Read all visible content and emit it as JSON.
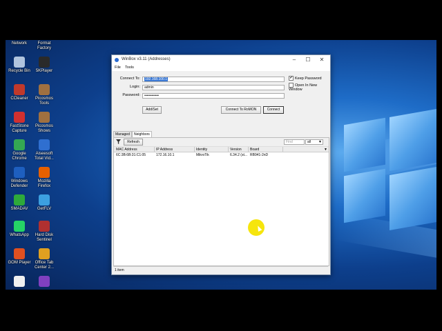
{
  "desktop": {
    "icons": [
      {
        "label": "Network",
        "color": "#4a8fd8"
      },
      {
        "label": "Format\nFactory",
        "color": "#d94a2a"
      },
      {
        "label": "Recycle Bin",
        "color": "#b0c4de"
      },
      {
        "label": "5KPlayer",
        "color": "#2a2a2a"
      },
      {
        "label": "CCleaner",
        "color": "#c0392b"
      },
      {
        "label": "Picosmos\nTools",
        "color": "#a07040"
      },
      {
        "label": "FastStone\nCapture",
        "color": "#d03030"
      },
      {
        "label": "Picosmos\nShows",
        "color": "#a07040"
      },
      {
        "label": "Google\nChrome",
        "color": "#34a853"
      },
      {
        "label": "Aiseesoft\nTotal Vid...",
        "color": "#2f6fd0"
      },
      {
        "label": "Windows\nDefender",
        "color": "#1e5fbf"
      },
      {
        "label": "Mozilla\nFirefox",
        "color": "#e66000"
      },
      {
        "label": "SMADAV",
        "color": "#2eaa3a"
      },
      {
        "label": "GetFLV",
        "color": "#3ca0e0"
      },
      {
        "label": "WhatsApp",
        "color": "#25d366"
      },
      {
        "label": "Hard Disk\nSentinel",
        "color": "#b03030"
      },
      {
        "label": "GOM Player",
        "color": "#e05020"
      },
      {
        "label": "Office Tab\nCenter 2...",
        "color": "#e0a020"
      },
      {
        "label": "",
        "color": "#f0f0f0"
      },
      {
        "label": "",
        "color": "#8040c0"
      }
    ]
  },
  "window": {
    "title": "WinBox v3.11 (Addresses)",
    "controls": {
      "minimize": "–",
      "maximize": "☐",
      "close": "✕"
    },
    "menu": [
      "File",
      "Tools"
    ],
    "connect_form": {
      "connect_to_label": "Connect To:",
      "connect_to_value": "192.168.100.1",
      "login_label": "Login:",
      "login_value": "admin",
      "password_label": "Password:",
      "password_value": "••••••••••••",
      "keep_password": {
        "label": "Keep Password",
        "checked": true,
        "mark": "✔"
      },
      "open_new_window": {
        "label": "Open In New Window",
        "checked": false
      },
      "add_set_button": "Add/Set",
      "connect_romon_button": "Connect To RoMON",
      "connect_button": "Connect"
    },
    "tabs": [
      "Managed",
      "Neighbors"
    ],
    "active_tab": "Neighbors",
    "toolbar": {
      "filter_icon": "funnel-icon",
      "refresh_button": "Refresh",
      "find_placeholder": "Find",
      "filter_select": "all"
    },
    "table": {
      "columns": [
        "MAC Address",
        "IP Address",
        "Identity",
        "Version",
        "Board"
      ],
      "rows": [
        [
          "6C:3B:6B:31:C1:05",
          "172.16.10.1",
          "MikroTik",
          "6.34.2 (st...",
          "RB941-2nD"
        ]
      ]
    },
    "status": "1 item"
  }
}
